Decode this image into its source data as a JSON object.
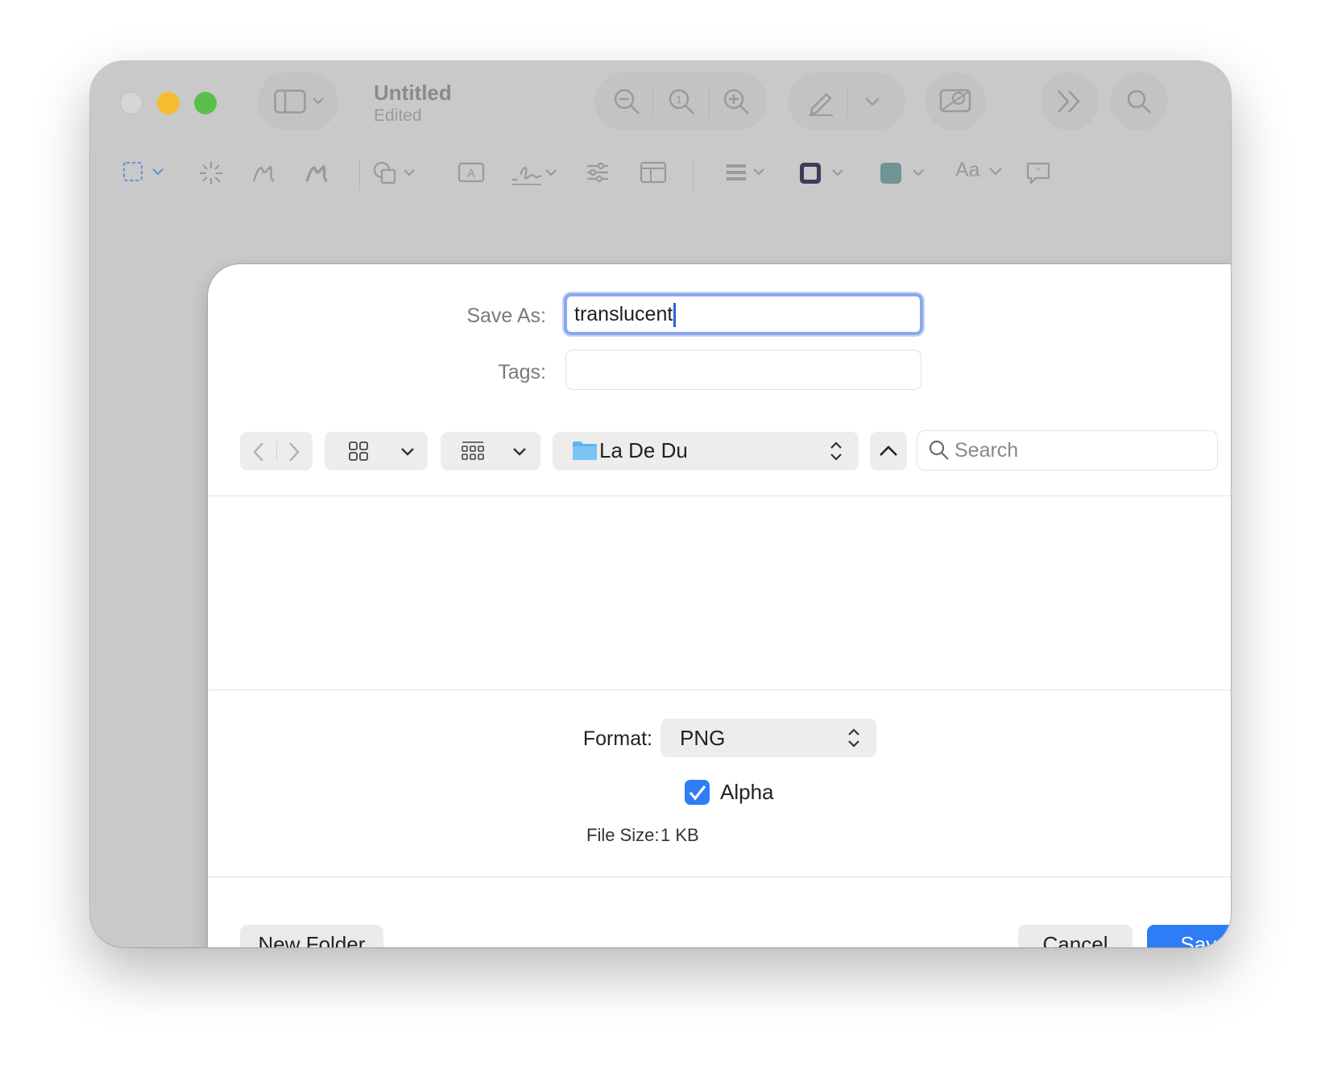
{
  "window": {
    "title": "Untitled",
    "subtitle": "Edited",
    "toolbar_icons": [
      "sidebar-icon",
      "zoom-out-icon",
      "actual-size-icon",
      "zoom-in-icon",
      "markup-pen-icon",
      "chevron-down-icon",
      "crop-icon",
      "more-icon",
      "search-icon"
    ],
    "markup_icons": [
      "rect-select-icon",
      "instant-alpha-icon",
      "sketch-icon",
      "draw-icon",
      "shapes-icon",
      "text-box-icon",
      "signature-icon",
      "adjust-color-icon",
      "page-layout-icon",
      "line-style-icon",
      "border-color-icon",
      "fill-color-icon",
      "text-style-icon",
      "note-icon"
    ],
    "text_style_label": "Aa",
    "fill_color": "#6f9494",
    "border_color": "#3c3c5a"
  },
  "sheet": {
    "save_as_label": "Save As:",
    "save_as_value": "translucent",
    "tags_label": "Tags:",
    "tags_value": "",
    "location": "La De Du",
    "search_placeholder": "Search",
    "format_label": "Format:",
    "format_value": "PNG",
    "alpha_label": "Alpha",
    "alpha_checked": true,
    "file_size_label": "File Size:",
    "file_size_value": "1 KB",
    "new_folder_label": "New Folder",
    "cancel_label": "Cancel",
    "save_label": "Save",
    "accent": "#2f7df6"
  }
}
